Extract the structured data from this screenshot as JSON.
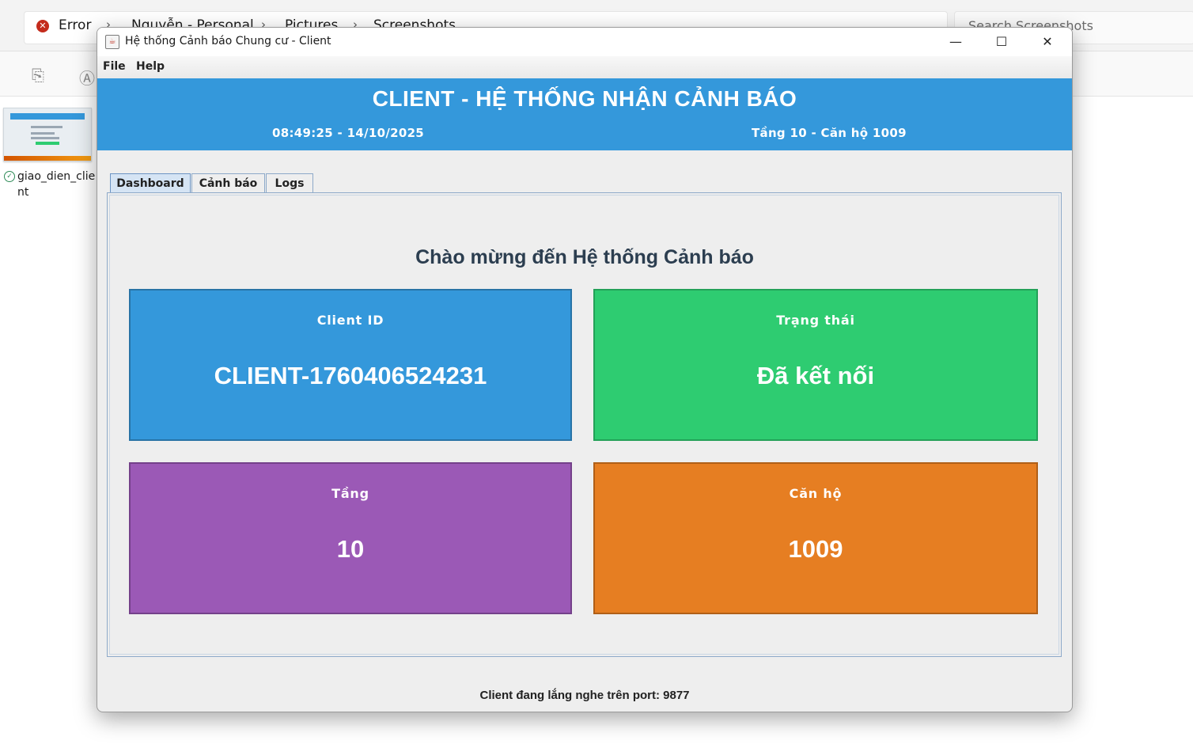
{
  "explorer": {
    "error_label": "Error",
    "breadcrumbs": [
      "Nguyễn - Personal",
      "Pictures",
      "Screenshots"
    ],
    "search_placeholder": "Search Screenshots",
    "file_name": "giao_dien_client"
  },
  "window": {
    "title": "Hệ thống Cảnh báo Chung cư - Client",
    "minimize": "—",
    "maximize": "☐",
    "close": "✕"
  },
  "menu": [
    "File",
    "Help"
  ],
  "header": {
    "title": "CLIENT - HỆ THỐNG NHẬN CẢNH BÁO",
    "time": "08:49:25 - 14/10/2025",
    "location": "Tầng 10 - Căn hộ 1009"
  },
  "tabs": [
    {
      "label": "Dashboard",
      "active": true
    },
    {
      "label": "Cảnh báo",
      "active": false
    },
    {
      "label": "Logs",
      "active": false
    }
  ],
  "dashboard": {
    "welcome": "Chào mừng đến Hệ thống Cảnh báo",
    "cards": [
      {
        "label": "Client ID",
        "value": "CLIENT-1760406524231",
        "color": "#3498db",
        "border": "#2873a6"
      },
      {
        "label": "Trạng thái",
        "value": "Đã kết nối",
        "color": "#2ecc71",
        "border": "#23a158"
      },
      {
        "label": "Tầng",
        "value": "10",
        "color": "#9b59b6",
        "border": "#74408a"
      },
      {
        "label": "Căn hộ",
        "value": "1009",
        "color": "#e67e22",
        "border": "#b05f17"
      }
    ]
  },
  "status_bar": "Client đang lắng nghe trên port: 9877"
}
